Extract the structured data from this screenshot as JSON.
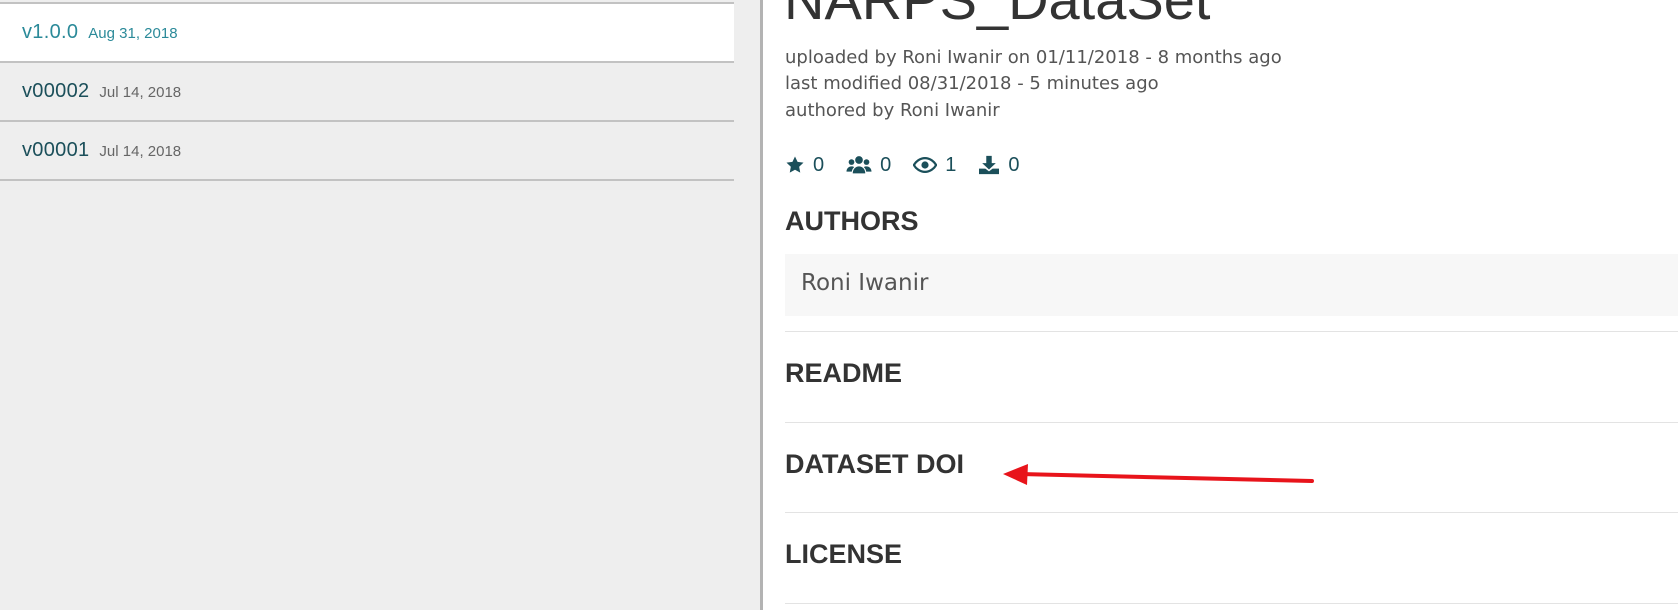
{
  "versions": [
    {
      "label": "v1.0.0",
      "date": "Aug 31, 2018"
    },
    {
      "label": "v00002",
      "date": "Jul 14, 2018"
    },
    {
      "label": "v00001",
      "date": "Jul 14, 2018"
    }
  ],
  "dataset": {
    "title": "NARPS_DataSet",
    "uploaded": "uploaded by Roni Iwanir on 01/11/2018 - 8 months ago",
    "modified": "last modified 08/31/2018 - 5 minutes ago",
    "authored": "authored by Roni Iwanir"
  },
  "stats": {
    "stars": "0",
    "followers": "0",
    "views": "1",
    "downloads": "0"
  },
  "icons": {
    "stars": "star-icon",
    "followers": "users-icon",
    "views": "eye-icon",
    "downloads": "download-icon"
  },
  "sections": {
    "authors": "AUTHORS",
    "authors_value": "Roni Iwanir",
    "readme": "README",
    "doi": "DATASET DOI",
    "license": "LICENSE"
  },
  "colors": {
    "accent": "#1b4f5a",
    "active_version": "#2b8a99",
    "annotation": "#e8141b"
  }
}
